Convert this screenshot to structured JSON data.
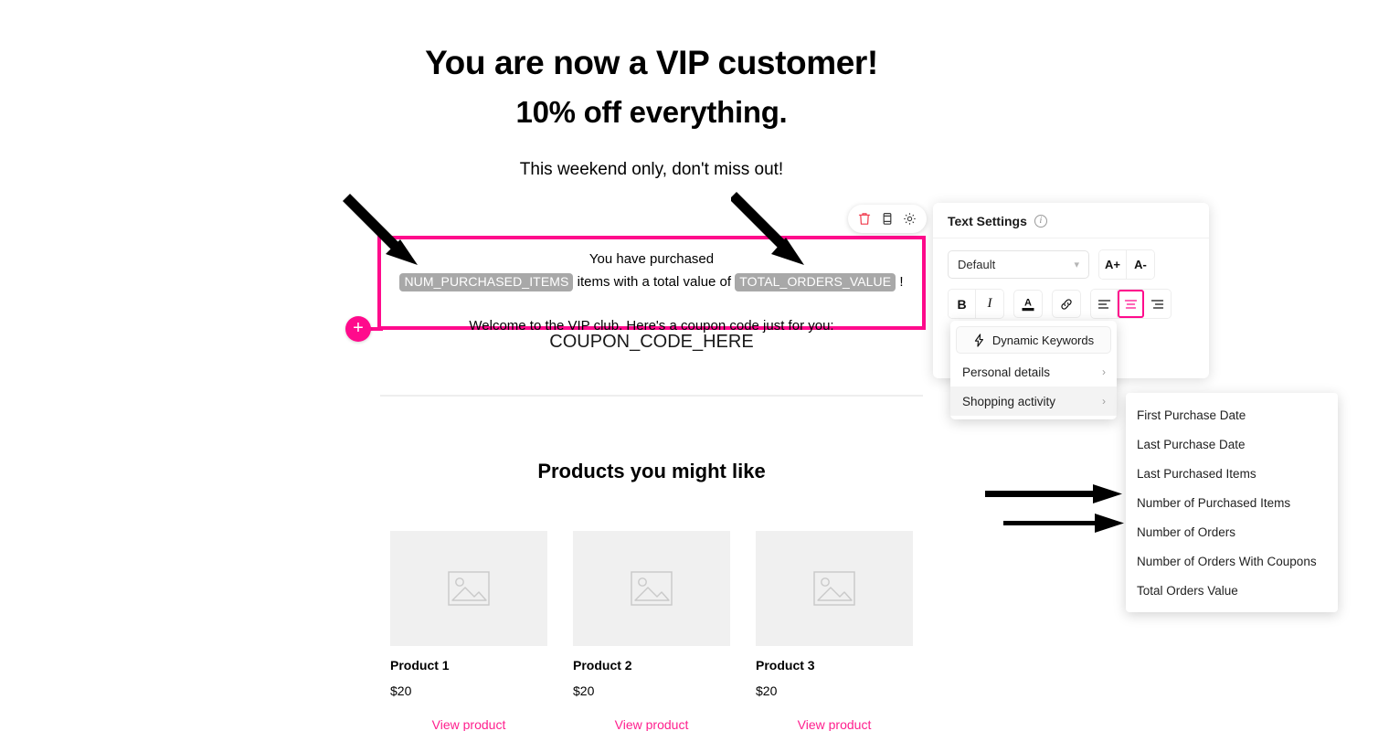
{
  "email": {
    "headline_1": "You are now a VIP customer!",
    "headline_2": "10% off everything.",
    "subheadline": "This weekend only, don't miss out!",
    "selected_block": {
      "line_1": "You have purchased",
      "keyword_1": "NUM_PURCHASED_ITEMS",
      "line_2_mid": " items with a total value of ",
      "keyword_2": "TOTAL_ORDERS_VALUE",
      "line_2_end": " !",
      "line_3": "Welcome to the VIP club. Here's a coupon code just for you:"
    },
    "coupon_code": "COUPON_CODE_HERE",
    "products_heading": "Products you might like",
    "products": [
      {
        "name": "Product 1",
        "price": "$20",
        "link_label": "View product",
        "thumb_icon": "image-placeholder-icon"
      },
      {
        "name": "Product 2",
        "price": "$20",
        "link_label": "View product",
        "thumb_icon": "image-placeholder-icon"
      },
      {
        "name": "Product 3",
        "price": "$20",
        "link_label": "View product",
        "thumb_icon": "image-placeholder-icon"
      }
    ]
  },
  "block_toolbar": {
    "delete_icon": "trash-icon",
    "duplicate_icon": "duplicate-icon",
    "settings_icon": "gear-icon"
  },
  "add_block_handle": {
    "icon": "plus-icon",
    "label": "+"
  },
  "text_settings": {
    "title": "Text Settings",
    "info_icon": "info-icon",
    "font_select": {
      "value": "Default",
      "chevron_icon": "chevron-down-icon"
    },
    "increase_font_label": "A+",
    "decrease_font_label": "A-",
    "bold_label": "B",
    "italic_label": "I",
    "text_color_label": "A",
    "link_icon": "link-icon",
    "align_left_icon": "align-left-icon",
    "align_center_icon": "align-center-icon",
    "align_right_icon": "align-right-icon",
    "active_alignment": "center"
  },
  "dynamic_keywords": {
    "button_label": "Dynamic Keywords",
    "button_icon": "lightning-bolt-icon",
    "items": [
      {
        "label": "Personal details",
        "arrow_icon": "chevron-right-icon",
        "highlighted": false
      },
      {
        "label": "Shopping activity",
        "arrow_icon": "chevron-right-icon",
        "highlighted": true
      }
    ]
  },
  "shopping_activity_submenu": {
    "items": [
      "First Purchase Date",
      "Last Purchase Date",
      "Last Purchased Items",
      "Number of Purchased Items",
      "Number of Orders",
      "Number of Orders With Coupons",
      "Total Orders Value"
    ]
  },
  "annotations": {
    "arrow_1": "diagonal-arrow-to-num-purchased-items",
    "arrow_2": "diagonal-arrow-to-total-orders-value",
    "arrow_3": "horizontal-arrow-to-number-of-purchased-items",
    "arrow_4": "horizontal-arrow-to-number-of-orders"
  },
  "colors": {
    "accent_pink": "#ff0a8c",
    "link_pink": "#ff1f8e",
    "keyword_tag_gray": "#a8a8a8",
    "delete_red": "#f0394b"
  }
}
